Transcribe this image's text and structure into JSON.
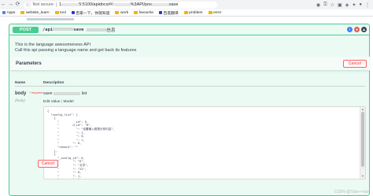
{
  "browser": {
    "warning": "Not secure",
    "url_prefix": "1",
    "url_mid": "5:5100/apidocs/#/",
    "url_tail": "%3API/pos",
    "url_end": "save"
  },
  "bookmarks": [
    {
      "label": "Apps"
    },
    {
      "label": "website_learn"
    },
    {
      "label": "tool"
    },
    {
      "label": "百家一下，你就知道"
    },
    {
      "label": "work"
    },
    {
      "label": "favourite"
    },
    {
      "label": "百度翻译"
    },
    {
      "label": "problem"
    },
    {
      "label": "error"
    }
  ],
  "operation": {
    "method": "POST",
    "path_prefix": "/api",
    "path_suffix": "save",
    "desc_tail": "信息"
  },
  "description": {
    "line1": "This is the language awesomeness API",
    "line2": "Call this api passing a language name and get back its features"
  },
  "parameters": {
    "title": "Parameters",
    "cancel_label": "Cancel",
    "col_name": "Name",
    "col_description": "Description",
    "param_name": "body",
    "required_label": "* required",
    "param_in": "(body)",
    "param_desc_prefix": "save",
    "param_desc_suffix": "list",
    "tab_example": "Edit Value",
    "tab_sep": "|",
    "tab_model": "Model"
  },
  "editor": {
    "lines": [
      "{",
      "  \"config_list\": [",
      "    {",
      "      \"         _id\": 5,",
      "      \"        d_id\": \"0\",",
      "      \"          \": \"设置输入框提示的内容\",",
      "      \"          \": 1,",
      "      \"          \": 0,",
      "      \"          \": 1,",
      "      \"        \": 0,",
      "      \"remark\": \"\"",
      "    },",
      "    {",
      "      \"_config_id\": 6,",
      "      \"        \": \"6\",",
      "      \"        \": \"文字\",",
      "      \"        \": \"22\",",
      "      \"        \": 0,",
      "      \"        \": 1,",
      "      \"        \": 0"
    ]
  },
  "footer": {
    "cancel_label": "Cancel",
    "watermark": "CSDN @Tabe++dax"
  },
  "colors": {
    "post": "#49cc90",
    "cancel": "#ff6060"
  }
}
